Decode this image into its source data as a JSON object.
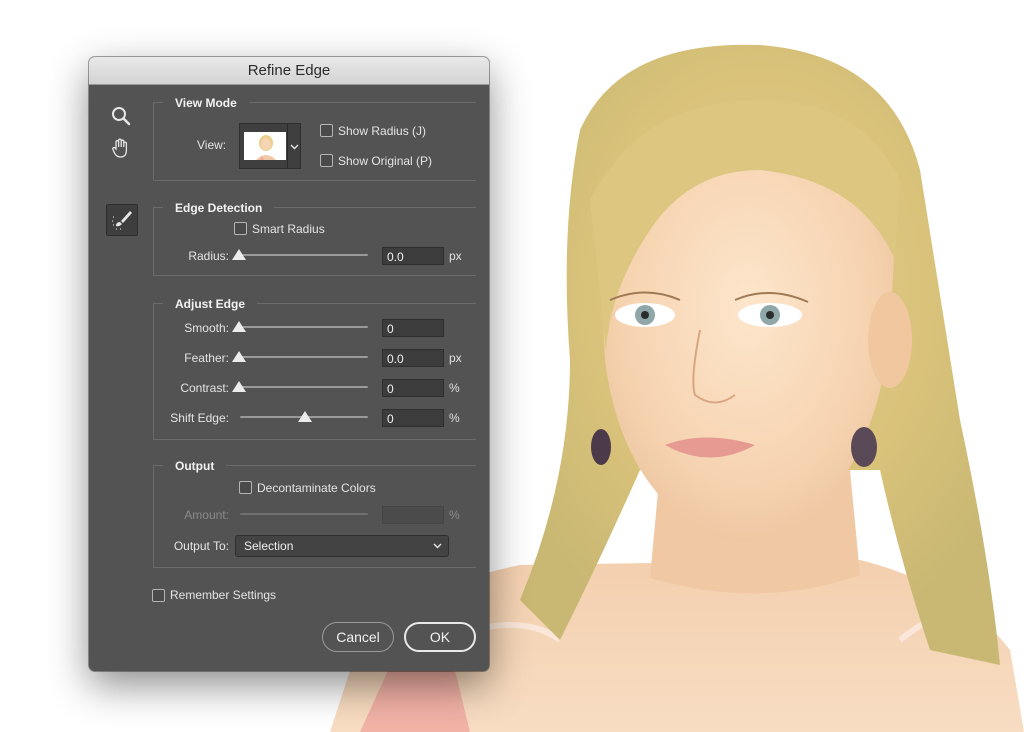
{
  "dialog": {
    "title": "Refine Edge",
    "tools": {
      "zoom_icon": "zoom-magnifier-icon",
      "hand_icon": "hand-icon",
      "refine_radius_icon": "refine-radius-brush-icon"
    },
    "view_mode": {
      "title": "View Mode",
      "view_label": "View:",
      "show_radius": "Show Radius (J)",
      "show_original": "Show Original (P)"
    },
    "edge_detection": {
      "title": "Edge Detection",
      "smart_radius": "Smart Radius",
      "radius_label": "Radius:",
      "radius_value": "0.0",
      "radius_unit": "px",
      "radius_level": 0
    },
    "adjust_edge": {
      "title": "Adjust Edge",
      "smooth_label": "Smooth:",
      "smooth_value": "0",
      "smooth_level": 0,
      "feather_label": "Feather:",
      "feather_value": "0.0",
      "feather_unit": "px",
      "feather_level": 0,
      "contrast_label": "Contrast:",
      "contrast_value": "0",
      "contrast_unit": "%",
      "contrast_level": 0,
      "shift_label": "Shift Edge:",
      "shift_value": "0",
      "shift_unit": "%",
      "shift_level": 0.5
    },
    "output": {
      "title": "Output",
      "decontaminate": "Decontaminate Colors",
      "amount_label": "Amount:",
      "amount_value": "",
      "amount_unit": "%",
      "output_to_label": "Output To:",
      "output_to_value": "Selection"
    },
    "remember_settings": "Remember Settings",
    "cancel_label": "Cancel",
    "ok_label": "OK"
  },
  "colors": {
    "dialog_bg": "#535353",
    "titlebar": "#d8d8d8"
  }
}
